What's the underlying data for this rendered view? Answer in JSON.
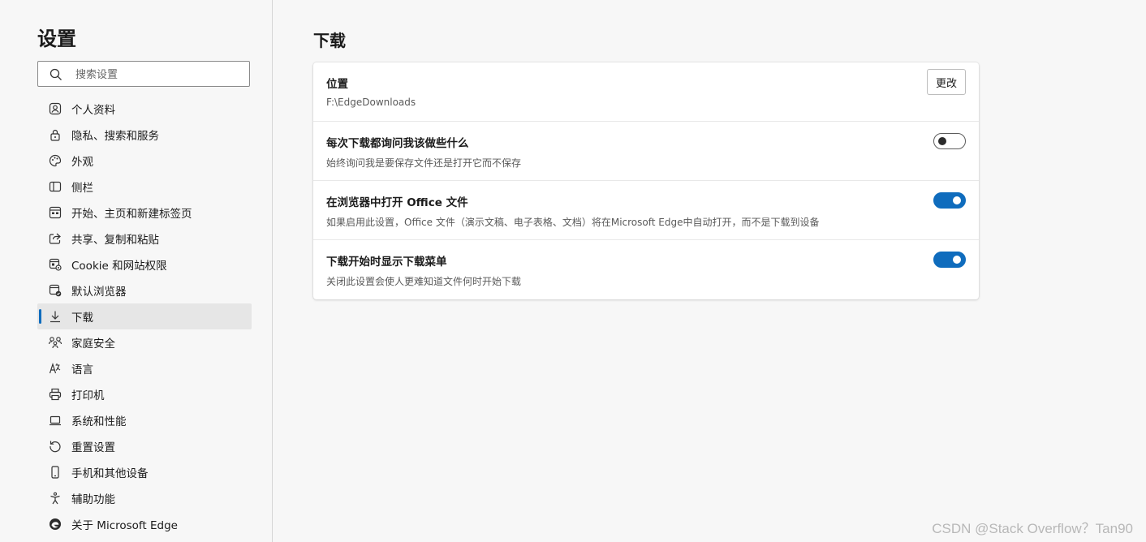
{
  "sidebar": {
    "title": "设置",
    "search_placeholder": "搜索设置",
    "items": [
      {
        "label": "个人资料",
        "icon": "profile-icon"
      },
      {
        "label": "隐私、搜索和服务",
        "icon": "lock-icon"
      },
      {
        "label": "外观",
        "icon": "palette-icon"
      },
      {
        "label": "侧栏",
        "icon": "sidebar-icon"
      },
      {
        "label": "开始、主页和新建标签页",
        "icon": "home-grid-icon"
      },
      {
        "label": "共享、复制和粘贴",
        "icon": "share-icon"
      },
      {
        "label": "Cookie 和网站权限",
        "icon": "site-permissions-icon"
      },
      {
        "label": "默认浏览器",
        "icon": "default-browser-icon"
      },
      {
        "label": "下载",
        "icon": "download-icon",
        "active": true
      },
      {
        "label": "家庭安全",
        "icon": "family-icon"
      },
      {
        "label": "语言",
        "icon": "language-icon"
      },
      {
        "label": "打印机",
        "icon": "printer-icon"
      },
      {
        "label": "系统和性能",
        "icon": "laptop-icon"
      },
      {
        "label": "重置设置",
        "icon": "reset-icon"
      },
      {
        "label": "手机和其他设备",
        "icon": "phone-icon"
      },
      {
        "label": "辅助功能",
        "icon": "accessibility-icon"
      },
      {
        "label": "关于 Microsoft Edge",
        "icon": "edge-logo-icon"
      }
    ]
  },
  "main": {
    "title": "下载",
    "rows": [
      {
        "title": "位置",
        "desc": "F:\\EdgeDownloads",
        "control": "button",
        "button_label": "更改"
      },
      {
        "title": "每次下载都询问我该做些什么",
        "desc": "始终询问我是要保存文件还是打开它而不保存",
        "control": "toggle",
        "toggle_on": false
      },
      {
        "title": "在浏览器中打开 Office 文件",
        "desc": "如果启用此设置，Office 文件（演示文稿、电子表格、文档）将在Microsoft Edge中自动打开，而不是下载到设备",
        "control": "toggle",
        "toggle_on": true
      },
      {
        "title": "下载开始时显示下载菜单",
        "desc": "关闭此设置会使人更难知道文件何时开始下载",
        "control": "toggle",
        "toggle_on": true
      }
    ]
  },
  "watermark": "CSDN @Stack Overflow？Tan90",
  "colors": {
    "accent": "#0f6cbd",
    "background": "#f7f7f7",
    "card": "#ffffff"
  }
}
